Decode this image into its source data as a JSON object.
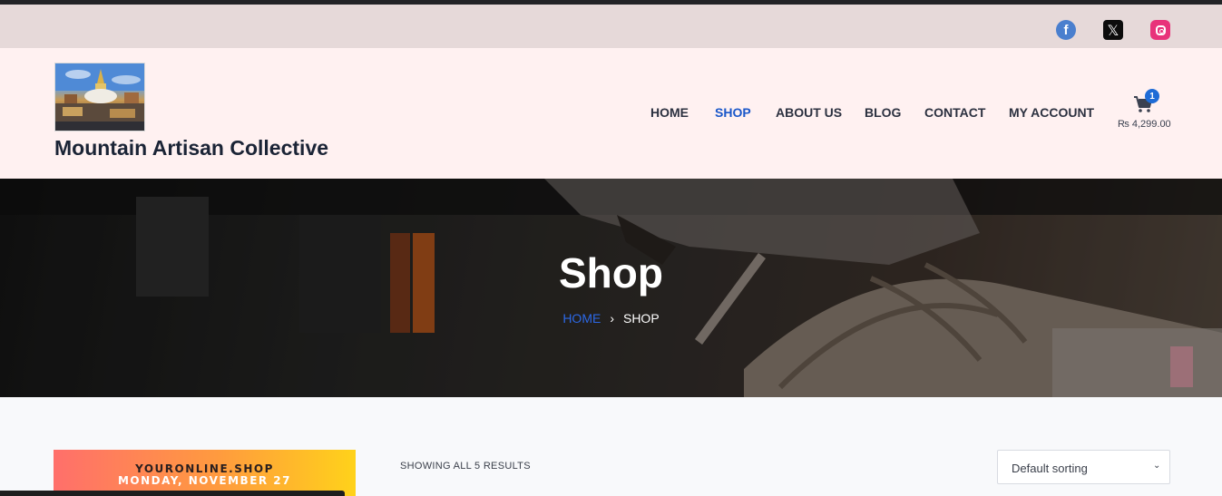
{
  "social": {
    "facebook_glyph": "f",
    "x_glyph": "𝕏",
    "facebook_color": "#4a7fce",
    "x_color": "#0c0c0c",
    "instagram_color": "#e8337a"
  },
  "header": {
    "site_title": "Mountain Artisan Collective",
    "nav": [
      {
        "label": "HOME",
        "active": false
      },
      {
        "label": "SHOP",
        "active": true
      },
      {
        "label": "ABOUT US",
        "active": false
      },
      {
        "label": "BLOG",
        "active": false
      },
      {
        "label": "CONTACT",
        "active": false
      },
      {
        "label": "MY ACCOUNT",
        "active": false
      }
    ],
    "cart": {
      "count": "1",
      "total": "₨ 4,299.00"
    },
    "accent_color": "#1a57c9"
  },
  "hero": {
    "title": "Shop",
    "breadcrumb": {
      "home": "HOME",
      "separator": "›",
      "current": "SHOP"
    }
  },
  "sidebar": {
    "promo": {
      "line1": "YOURONLINE.SHOP",
      "line2": "MONDAY, NOVEMBER 27"
    }
  },
  "shop": {
    "results_text": "SHOWING ALL 5 RESULTS",
    "sorting": {
      "selected": "Default sorting"
    }
  }
}
